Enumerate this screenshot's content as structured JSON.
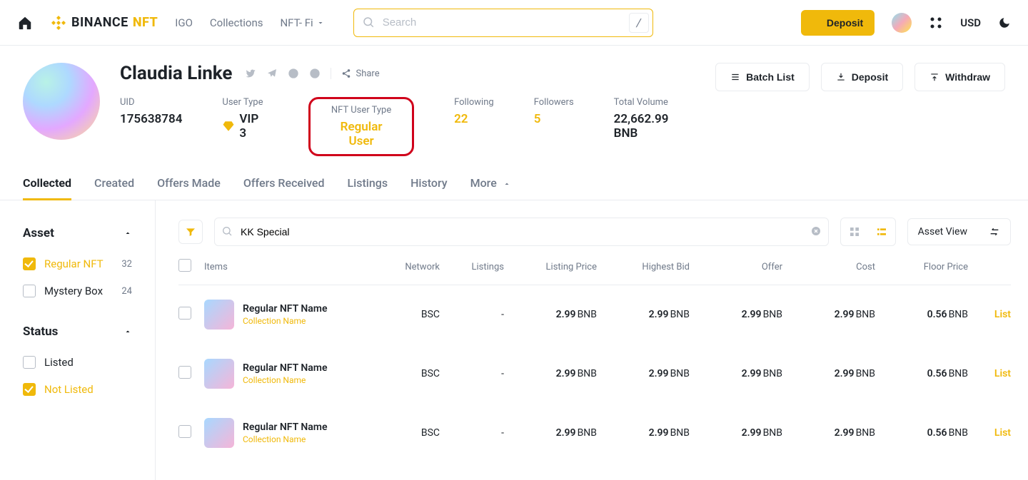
{
  "nav": {
    "brand_a": "BINANCE",
    "brand_b": "NFT",
    "links": [
      "IGO",
      "Collections",
      "NFT- Fi"
    ],
    "search_placeholder": "Search",
    "slash": "/",
    "deposit": "Deposit",
    "currency": "USD"
  },
  "profile": {
    "name": "Claudia Linke",
    "share_label": "Share",
    "actions": {
      "batch": "Batch List",
      "deposit": "Deposit",
      "withdraw": "Withdraw"
    },
    "stats": {
      "uid": {
        "label": "UID",
        "value": "175638784"
      },
      "user_type": {
        "label": "User Type",
        "value": "VIP 3"
      },
      "nft_user_type": {
        "label": "NFT User Type",
        "value": "Regular User"
      },
      "following": {
        "label": "Following",
        "value": "22"
      },
      "followers": {
        "label": "Followers",
        "value": "5"
      },
      "volume": {
        "label": "Total Volume",
        "value": "22,662.99 BNB"
      }
    }
  },
  "tabs": [
    "Collected",
    "Created",
    "Offers Made",
    "Offers Received",
    "Listings",
    "History",
    "More"
  ],
  "sidebar": {
    "asset": {
      "title": "Asset",
      "items": [
        {
          "label": "Regular NFT",
          "count": "32",
          "checked": true
        },
        {
          "label": "Mystery Box",
          "count": "24",
          "checked": false
        }
      ]
    },
    "status": {
      "title": "Status",
      "items": [
        {
          "label": "Listed",
          "checked": false
        },
        {
          "label": "Not Listed",
          "checked": true
        }
      ]
    }
  },
  "toolbar": {
    "query": "KK Special",
    "asset_view": "Asset View"
  },
  "table": {
    "headers": {
      "items": "Items",
      "network": "Network",
      "listings": "Listings",
      "listing_price": "Listing Price",
      "highest_bid": "Highest Bid",
      "offer": "Offer",
      "cost": "Cost",
      "floor": "Floor Price"
    },
    "list_label": "List",
    "rows": [
      {
        "name": "Regular NFT Name",
        "collection": "Collection Name",
        "network": "BSC",
        "listings": "-",
        "listing_price": "2.99",
        "highest_bid": "2.99",
        "offer": "2.99",
        "cost": "2.99",
        "floor": "0.56",
        "unit": "BNB"
      },
      {
        "name": "Regular NFT Name",
        "collection": "Collection Name",
        "network": "BSC",
        "listings": "-",
        "listing_price": "2.99",
        "highest_bid": "2.99",
        "offer": "2.99",
        "cost": "2.99",
        "floor": "0.56",
        "unit": "BNB"
      },
      {
        "name": "Regular NFT Name",
        "collection": "Collection Name",
        "network": "BSC",
        "listings": "-",
        "listing_price": "2.99",
        "highest_bid": "2.99",
        "offer": "2.99",
        "cost": "2.99",
        "floor": "0.56",
        "unit": "BNB"
      }
    ]
  }
}
